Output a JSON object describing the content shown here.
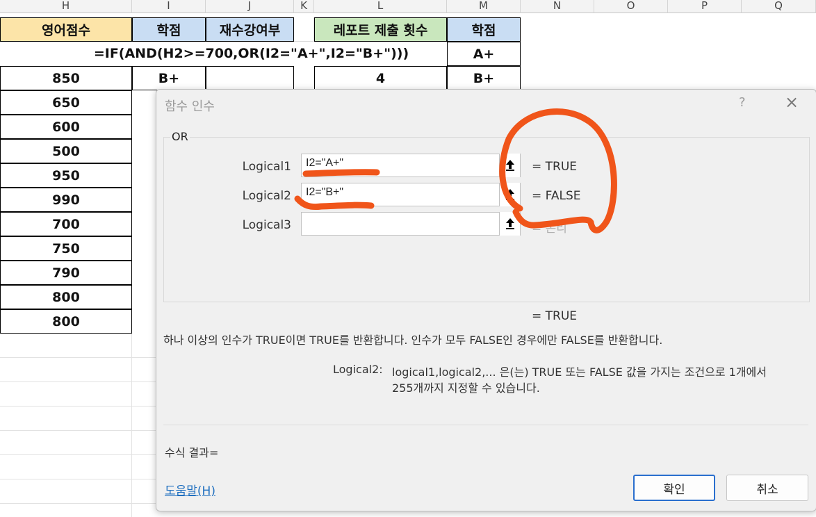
{
  "spreadsheet": {
    "column_headers": [
      "H",
      "I",
      "J",
      "K",
      "L",
      "M",
      "N",
      "O",
      "P",
      "Q"
    ],
    "header_row": {
      "h": "영어점수",
      "i": "학점",
      "j": "재수강여부",
      "l": "레포트 제출 횟수",
      "m": "학점"
    },
    "formula_text": "=IF(AND(H2>=700,OR(I2=\"A+\",I2=\"B+\")))",
    "m2": "A+",
    "row3": {
      "h": "850",
      "i": "B+",
      "l": "4",
      "m": "B+"
    },
    "h_values": [
      "650",
      "600",
      "500",
      "950",
      "990",
      "700",
      "750",
      "790",
      "800",
      "800"
    ]
  },
  "dialog": {
    "title": "함수 인수",
    "help_icon": "?",
    "close_icon": "×",
    "function_name": "OR",
    "args": [
      {
        "label": "Logical1",
        "value": "I2=\"A+\"",
        "result": "=  TRUE"
      },
      {
        "label": "Logical2",
        "value": "I2=\"B+\"",
        "result": "=  FALSE"
      },
      {
        "label": "Logical3",
        "value": "",
        "result": "=  논리"
      }
    ],
    "overall_result": "=  TRUE",
    "description": "하나 이상의 인수가 TRUE이면 TRUE를 반환합니다. 인수가 모두 FALSE인 경우에만 FALSE를 반환합니다.",
    "arg_help_label": "Logical2:",
    "arg_help_text_line1": "logical1,logical2,... 은(는) TRUE 또는 FALSE 값을 가지는 조건으로 1개에서",
    "arg_help_text_line2": "255개까지 지정할 수 있습니다.",
    "formula_result_label": "수식 결과=",
    "help_link": "도움말(H)",
    "ok_button": "확인",
    "cancel_button": "취소"
  },
  "colors": {
    "h_header_fill": "#fce4a8",
    "i_header_fill": "#c9ddf3",
    "l_header_fill": "#c9e7bd",
    "m_header_fill": "#c9ddf3",
    "annotation": "#f0551a",
    "primary_button_border": "#2a6fce"
  }
}
